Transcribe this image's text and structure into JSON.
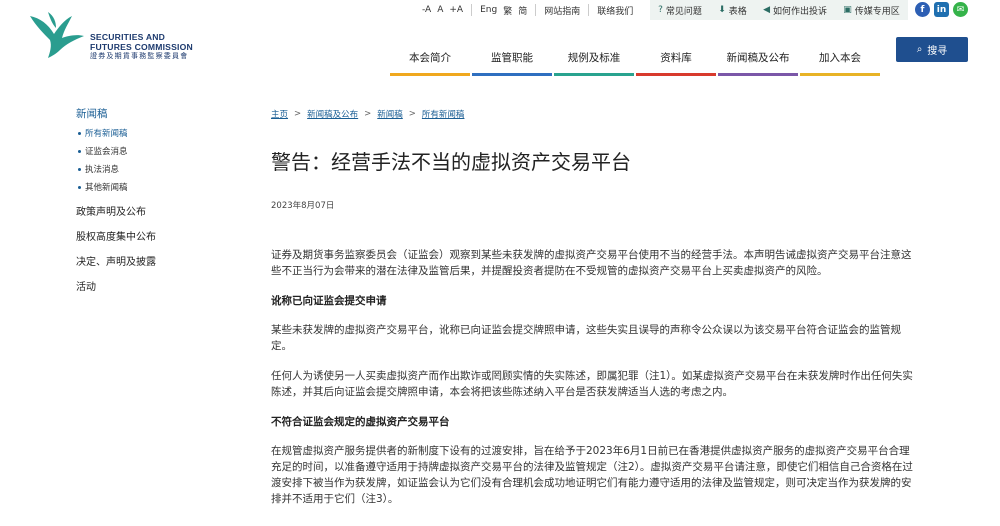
{
  "header": {
    "logo_en_line1": "SECURITIES AND",
    "logo_en_line2": "FUTURES COMMISSION",
    "logo_zh": "證券及期貨事務監察委員會",
    "font_sizes": [
      "-A",
      "A",
      "+A"
    ],
    "languages": [
      "Eng",
      "繁",
      "简"
    ],
    "links": [
      "网站指南",
      "联络我们"
    ],
    "quick_links": [
      "常见问题",
      "表格",
      "如何作出投诉",
      "传媒专用区"
    ],
    "search_label": "搜寻"
  },
  "nav": {
    "items": [
      {
        "label": "本会简介",
        "color": "#f0a81e"
      },
      {
        "label": "监管职能",
        "color": "#2f6fc0"
      },
      {
        "label": "规例及标准",
        "color": "#29a38f"
      },
      {
        "label": "资料库",
        "color": "#d83a2d"
      },
      {
        "label": "新闻稿及公布",
        "color": "#7b57a8"
      },
      {
        "label": "加入本会",
        "color": "#e8b326"
      }
    ]
  },
  "sidebar": {
    "heading": "新闻稿",
    "subitems": [
      "所有新闻稿",
      "证监会消息",
      "执法消息",
      "其他新闻稿"
    ],
    "items": [
      "政策声明及公布",
      "股权高度集中公布",
      "决定、声明及披露",
      "活动"
    ]
  },
  "breadcrumb": [
    "主页",
    "新闻稿及公布",
    "新闻稿",
    "所有新闻稿"
  ],
  "article": {
    "title": "警告：经营手法不当的虚拟资产交易平台",
    "date": "2023年8月07日",
    "intro": "证券及期货事务监察委员会（证监会）观察到某些未获发牌的虚拟资产交易平台使用不当的经营手法。本声明告诫虚拟资产交易平台注意这些不正当行为会带来的潜在法律及监管后果，并提醒投资者提防在不受规管的虚拟资产交易平台上买卖虚拟资产的风险。",
    "section1_title": "讹称已向证监会提交申请",
    "section1_p1": "某些未获发牌的虚拟资产交易平台，讹称已向证监会提交牌照申请，这些失实且误导的声称令公众误以为该交易平台符合证监会的监管规定。",
    "section1_p2": "任何人为诱使另一人买卖虚拟资产而作出欺诈或罔顾实情的失实陈述，即属犯罪（注1）。如某虚拟资产交易平台在未获发牌时作出任何失实陈述，并其后向证监会提交牌照申请，本会将把该些陈述纳入平台是否获发牌适当人选的考虑之内。",
    "section2_title": "不符合证监会规定的虚拟资产交易平台",
    "section2_p1": "在规管虚拟资产服务提供者的新制度下设有的过渡安排，旨在给予于2023年6月1日前已在香港提供虚拟资产服务的虚拟资产交易平台合理充足的时间，以准备遵守适用于持牌虚拟资产交易平台的法律及监管规定（注2）。虚拟资产交易平台请注意，即使它们相信自己合资格在过渡安排下被当作为获发牌，如证监会认为它们没有合理机会成功地证明它们有能力遵守适用的法律及监管规定，则可决定当作为获发牌的安排并不适用于它们（注3）。"
  }
}
